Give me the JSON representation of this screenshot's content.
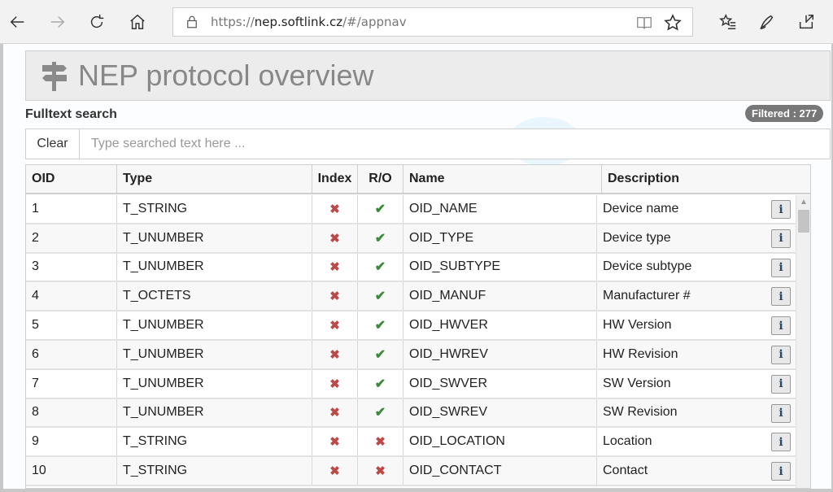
{
  "browser": {
    "url_prefix": "https://",
    "url_host": "nep.softlink.cz",
    "url_path": "/#/appnav"
  },
  "header": {
    "title": "NEP protocol overview"
  },
  "search": {
    "label": "Fulltext search",
    "filtered": "Filtered : 277",
    "clear_label": "Clear",
    "placeholder": "Type searched text here ...",
    "value": ""
  },
  "table": {
    "columns": [
      "OID",
      "Type",
      "Index",
      "R/O",
      "Name",
      "Description"
    ],
    "rows": [
      {
        "oid": "1",
        "type": "T_STRING",
        "index": "x",
        "ro": "ok",
        "name": "OID_NAME",
        "description": "Device name"
      },
      {
        "oid": "2",
        "type": "T_UNUMBER",
        "index": "x",
        "ro": "ok",
        "name": "OID_TYPE",
        "description": "Device type"
      },
      {
        "oid": "3",
        "type": "T_UNUMBER",
        "index": "x",
        "ro": "ok",
        "name": "OID_SUBTYPE",
        "description": "Device subtype"
      },
      {
        "oid": "4",
        "type": "T_OCTETS",
        "index": "x",
        "ro": "ok",
        "name": "OID_MANUF",
        "description": "Manufacturer #"
      },
      {
        "oid": "5",
        "type": "T_UNUMBER",
        "index": "x",
        "ro": "ok",
        "name": "OID_HWVER",
        "description": "HW Version"
      },
      {
        "oid": "6",
        "type": "T_UNUMBER",
        "index": "x",
        "ro": "ok",
        "name": "OID_HWREV",
        "description": "HW Revision"
      },
      {
        "oid": "7",
        "type": "T_UNUMBER",
        "index": "x",
        "ro": "ok",
        "name": "OID_SWVER",
        "description": "SW Version"
      },
      {
        "oid": "8",
        "type": "T_UNUMBER",
        "index": "x",
        "ro": "ok",
        "name": "OID_SWREV",
        "description": "SW Revision"
      },
      {
        "oid": "9",
        "type": "T_STRING",
        "index": "x",
        "ro": "x",
        "name": "OID_LOCATION",
        "description": "Location"
      },
      {
        "oid": "10",
        "type": "T_STRING",
        "index": "x",
        "ro": "x",
        "name": "OID_CONTACT",
        "description": "Contact"
      }
    ]
  },
  "marks": {
    "x": "✖",
    "ok": "✔"
  },
  "icons": {
    "info": "i"
  },
  "colors": {
    "cross": "#b94a48",
    "check": "#3c8a3c",
    "badge": "#777777"
  }
}
